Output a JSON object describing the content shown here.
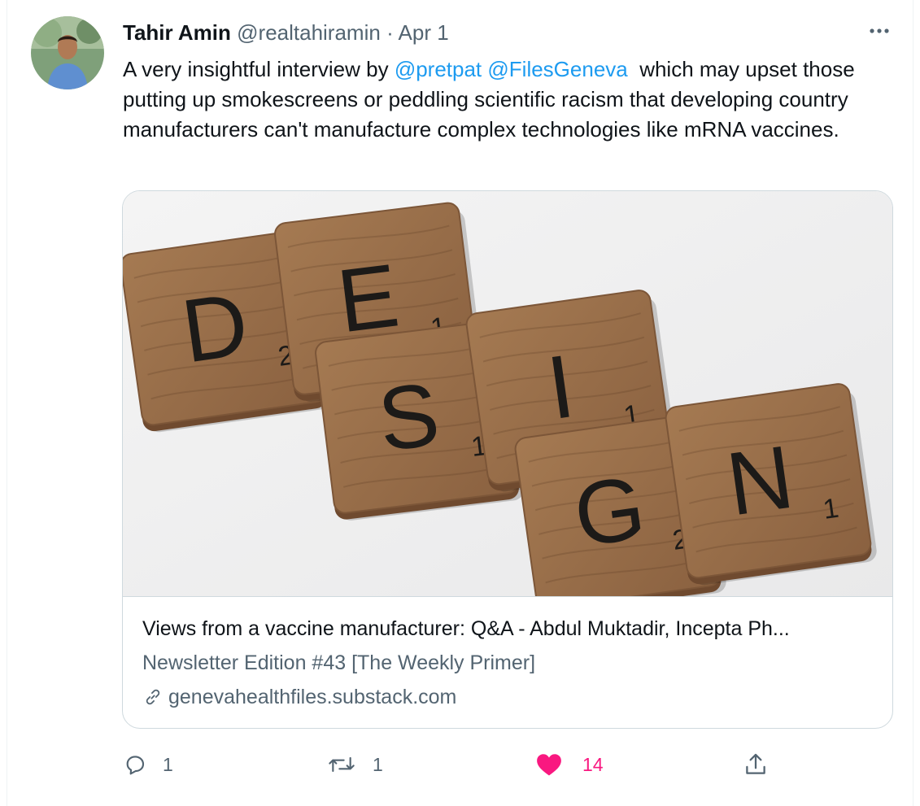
{
  "tweet": {
    "author_name": "Tahir Amin",
    "author_handle": "@realtahiramin",
    "separator": "·",
    "date": "Apr 1",
    "more_icon": "more-horizontal-icon",
    "text_before": "A very insightful interview by ",
    "mention_1": "@pretpat",
    "mention_2": "@FilesGeneva",
    "text_after": "  which may upset those putting up smokescreens or peddling scientific racism that developing country manufacturers can't manufacture complex technologies like mRNA vaccines."
  },
  "card": {
    "image_tiles": [
      {
        "letter": "D",
        "score": "2"
      },
      {
        "letter": "E",
        "score": "1"
      },
      {
        "letter": "S",
        "score": "1"
      },
      {
        "letter": "I",
        "score": "1"
      },
      {
        "letter": "G",
        "score": "2"
      },
      {
        "letter": "N",
        "score": "1"
      }
    ],
    "title": "Views from a vaccine manufacturer: Q&A - Abdul Muktadir, Incepta Ph...",
    "description": "Newsletter Edition #43 [The Weekly Primer]",
    "domain": "genevahealthfiles.substack.com",
    "domain_icon": "link-icon"
  },
  "actions": {
    "reply_count": "1",
    "retweet_count": "1",
    "like_count": "14",
    "reply_icon": "reply-icon",
    "retweet_icon": "retweet-icon",
    "like_icon": "heart-filled-icon",
    "share_icon": "share-icon"
  },
  "colors": {
    "accent": "#1d9bf0",
    "secondary_text": "#536471",
    "like": "#f91880"
  }
}
